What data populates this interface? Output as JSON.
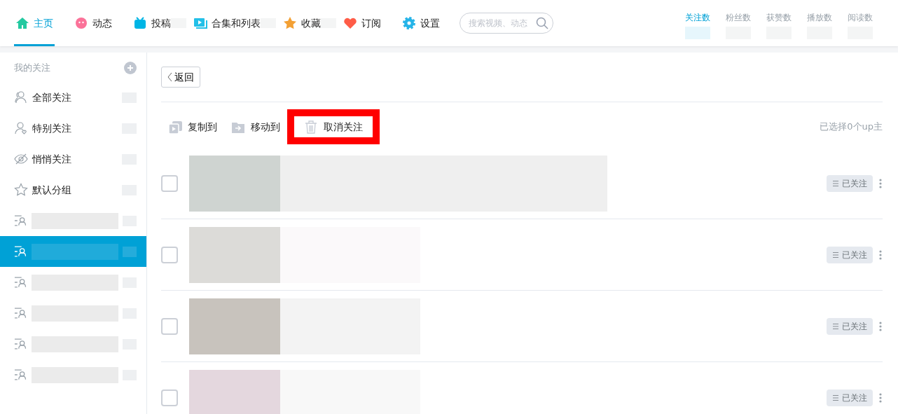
{
  "nav": {
    "tabs": [
      {
        "label": "主页",
        "kind": "home",
        "selected": true,
        "masked": false
      },
      {
        "label": "动态",
        "kind": "flower",
        "selected": false,
        "masked": false
      },
      {
        "label": "投稿",
        "kind": "tv",
        "selected": false,
        "masked": true
      },
      {
        "label": "合集和列表",
        "kind": "play",
        "selected": false,
        "masked": true
      },
      {
        "label": "收藏",
        "kind": "star",
        "selected": false,
        "masked": true
      },
      {
        "label": "订阅",
        "kind": "heart",
        "selected": false,
        "masked": false
      },
      {
        "label": "设置",
        "kind": "gear",
        "selected": false,
        "masked": false
      }
    ],
    "search": {
      "placeholder": "搜索视频、动态"
    },
    "stats": [
      {
        "label": "关注数",
        "selected": true
      },
      {
        "label": "粉丝数",
        "selected": false
      },
      {
        "label": "获赞数",
        "selected": false
      },
      {
        "label": "播放数",
        "selected": false
      },
      {
        "label": "阅读数",
        "selected": false
      }
    ]
  },
  "sidebar": {
    "title": "我的关注",
    "items": [
      {
        "label": "全部关注",
        "kind": "person",
        "selected": false
      },
      {
        "label": "特别关注",
        "kind": "heart-person",
        "selected": false
      },
      {
        "label": "悄悄关注",
        "kind": "eye",
        "selected": false
      },
      {
        "label": "默认分组",
        "kind": "star",
        "selected": false
      }
    ],
    "groups": [
      {
        "selected": false
      },
      {
        "selected": true
      },
      {
        "selected": false
      },
      {
        "selected": false
      },
      {
        "selected": false
      },
      {
        "selected": false
      }
    ]
  },
  "main": {
    "back": "返回",
    "actions": [
      {
        "label": "复制到",
        "kind": "copy",
        "highlighted": false
      },
      {
        "label": "移动到",
        "kind": "move",
        "highlighted": false
      },
      {
        "label": "取消关注",
        "kind": "trash",
        "highlighted": true
      }
    ],
    "selection": "已选择0个up主",
    "rows": [
      {
        "checked": false,
        "button": "已关注"
      },
      {
        "checked": false,
        "button": "已关注"
      },
      {
        "checked": false,
        "button": "已关注"
      },
      {
        "checked": false,
        "button": "已关注"
      }
    ]
  }
}
